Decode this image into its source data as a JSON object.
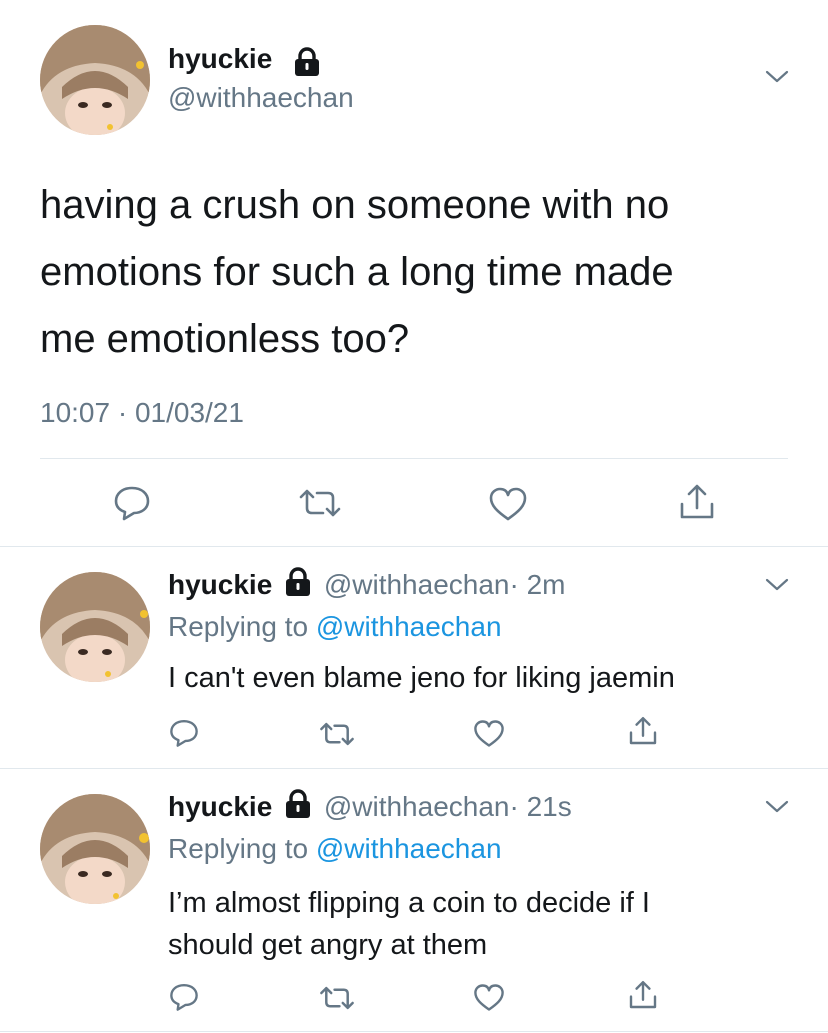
{
  "main_tweet": {
    "display_name": "hyuckie",
    "handle": "@withhaechan",
    "text_lines": [
      "having a crush on someone with no",
      "emotions for such a long time made",
      "me emotionless too?"
    ],
    "timestamp": "10:07 · 01/03/21",
    "icons": [
      "lock-icon",
      "chevron-down-icon",
      "reply-icon",
      "retweet-icon",
      "like-icon",
      "share-icon"
    ]
  },
  "replies": [
    {
      "display_name": "hyuckie",
      "handle": "@withhaechan",
      "time": "· 2m",
      "replying_prefix": "Replying to",
      "replying_to": "@withhaechan",
      "text_lines": [
        "I can't even blame jeno for liking jaemin"
      ]
    },
    {
      "display_name": "hyuckie",
      "handle": "@withhaechan",
      "time": "· 21s",
      "replying_prefix": "Replying to",
      "replying_to": "@withhaechan",
      "text_lines": [
        "I’m almost flipping a coin to decide if I",
        "should get angry at them"
      ]
    }
  ],
  "colors": {
    "text": "#14171a",
    "secondary": "#657786",
    "link": "#1b95e0",
    "divider": "#e1e8ed"
  }
}
